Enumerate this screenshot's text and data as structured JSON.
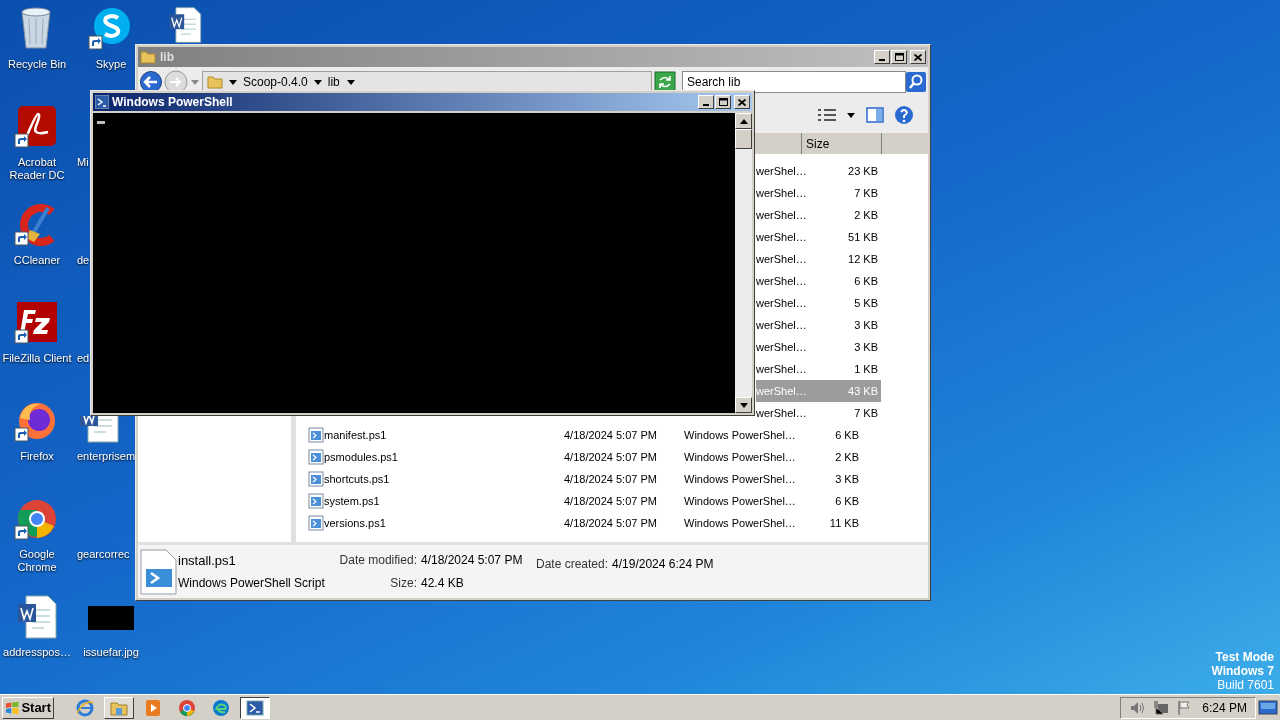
{
  "desktop": {
    "icons": [
      {
        "label": "Recycle Bin",
        "kind": "recycle",
        "shortcut": false
      },
      {
        "label": "Acrobat Reader DC",
        "kind": "acrobat",
        "shortcut": true
      },
      {
        "label": "CCleaner",
        "kind": "ccleaner",
        "shortcut": true
      },
      {
        "label": "FileZilla Client",
        "kind": "filezilla",
        "shortcut": true
      },
      {
        "label": "Firefox",
        "kind": "firefox",
        "shortcut": true
      },
      {
        "label": "Google Chrome",
        "kind": "chrome",
        "shortcut": true
      },
      {
        "label": "addresspos…",
        "kind": "word",
        "shortcut": false
      },
      {
        "label": "Skype",
        "kind": "skype",
        "shortcut": true
      },
      {
        "label": "Mi",
        "label_cut": true
      },
      {
        "label": "de",
        "label_cut": true
      },
      {
        "label": "ed",
        "label_cut": true
      },
      {
        "label": "enterprisem",
        "kind": "word",
        "shortcut": false,
        "clipped": true,
        "label_cut": true
      },
      {
        "label": "gearcorrec",
        "label_cut": true
      },
      {
        "label": "issuefar.jpg",
        "kind": "image",
        "shortcut": false
      },
      {
        "kind": "word",
        "shortcut": false
      }
    ]
  },
  "explorer": {
    "title": "lib",
    "breadcrumb": [
      "Scoop-0.4.0",
      "lib"
    ],
    "search": {
      "placeholder": "Search lib"
    },
    "columns": [
      "Size"
    ],
    "rows": [
      {
        "type": "werShel…",
        "size": "23 KB",
        "selected": false
      },
      {
        "type": "werShel…",
        "size": "7 KB",
        "selected": false
      },
      {
        "type": "werShel…",
        "size": "2 KB",
        "selected": false
      },
      {
        "type": "werShel…",
        "size": "51 KB",
        "selected": false
      },
      {
        "type": "werShel…",
        "size": "12 KB",
        "selected": false
      },
      {
        "type": "werShel…",
        "size": "6 KB",
        "selected": false
      },
      {
        "type": "werShel…",
        "size": "5 KB",
        "selected": false
      },
      {
        "type": "werShel…",
        "size": "3 KB",
        "selected": false
      },
      {
        "type": "werShel…",
        "size": "3 KB",
        "selected": false
      },
      {
        "type": "werShel…",
        "size": "1 KB",
        "selected": false
      },
      {
        "type": "werShel…",
        "size": "43 KB",
        "selected": true
      },
      {
        "type": "werShel…",
        "size": "7 KB",
        "selected": false
      },
      {
        "name": "manifest.ps1",
        "date": "4/18/2024 5:07 PM",
        "type": "Windows PowerShel…",
        "size": "6 KB",
        "selected": false
      },
      {
        "name": "psmodules.ps1",
        "date": "4/18/2024 5:07 PM",
        "type": "Windows PowerShel…",
        "size": "2 KB",
        "selected": false
      },
      {
        "name": "shortcuts.ps1",
        "date": "4/18/2024 5:07 PM",
        "type": "Windows PowerShel…",
        "size": "3 KB",
        "selected": false
      },
      {
        "name": "system.ps1",
        "date": "4/18/2024 5:07 PM",
        "type": "Windows PowerShel…",
        "size": "6 KB",
        "selected": false
      },
      {
        "name": "versions.ps1",
        "date": "4/18/2024 5:07 PM",
        "type": "Windows PowerShel…",
        "size": "11 KB",
        "selected": false
      }
    ],
    "details": {
      "name": "install.ps1",
      "file_type": "Windows PowerShell Script",
      "date_modified_label": "Date modified:",
      "date_modified": "4/18/2024 5:07 PM",
      "size_label": "Size:",
      "size": "42.4 KB",
      "date_created_label": "Date created:",
      "date_created": "4/19/2024 6:24 PM"
    }
  },
  "powershell": {
    "title": "Windows PowerShell"
  },
  "taskbar": {
    "start": "Start",
    "apps": [
      {
        "kind": "ie",
        "open": false,
        "selected": false
      },
      {
        "kind": "folder",
        "open": true,
        "selected": false
      },
      {
        "kind": "media",
        "open": false,
        "selected": false
      },
      {
        "kind": "chrome",
        "open": false,
        "selected": false
      },
      {
        "kind": "edge",
        "open": false,
        "selected": false
      },
      {
        "kind": "powershell",
        "open": true,
        "selected": true
      }
    ],
    "clock": "6:24 PM"
  },
  "os_notice": [
    "Test Mode",
    "Windows 7",
    "Build 7601"
  ]
}
